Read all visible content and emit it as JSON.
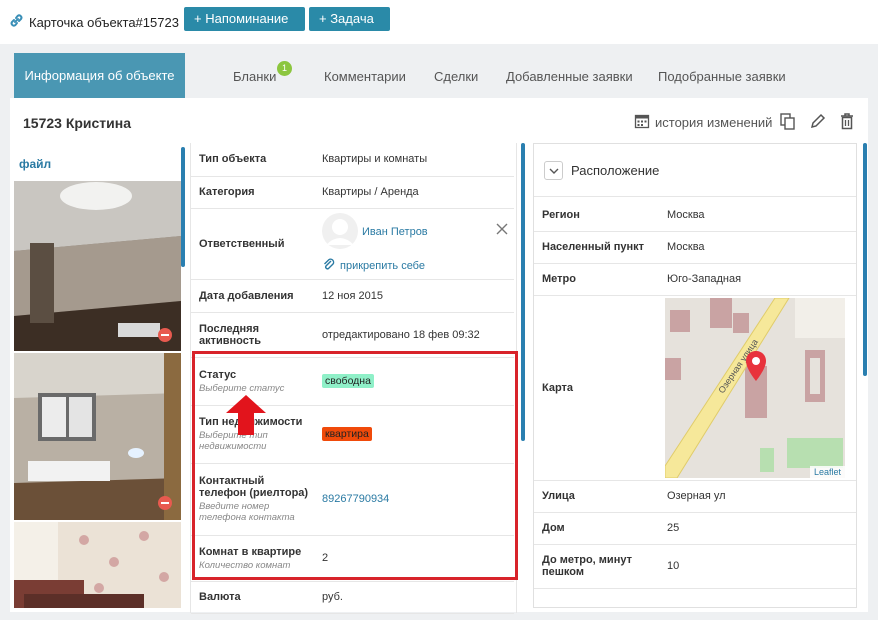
{
  "header": {
    "object_card": "Карточка объекта#15723",
    "reminder_button": "+ Напоминание",
    "task_button": "+ Задача"
  },
  "tabs": {
    "active": "Информация об объекте",
    "forms": "Бланки",
    "forms_badge": "1",
    "comments": "Комментарии",
    "deals": "Сделки",
    "added_requests": "Добавленные заявки",
    "matched_requests": "Подобранные заявки"
  },
  "page": {
    "title": "15723 Кристина",
    "history": "история изменений",
    "file_link": "файл"
  },
  "details": {
    "object_type_label": "Тип объекта",
    "object_type_value": "Квартиры и комнаты",
    "category_label": "Категория",
    "category_value": "Квартиры / Аренда",
    "responsible_label": "Ответственный",
    "responsible_name": "Иван Петров",
    "attach_self": "прикрепить себе",
    "added_date_label": "Дата добавления",
    "added_date_value": "12 ноя 2015",
    "last_activity_label": "Последняя активность",
    "last_activity_value": "отредактировано 18 фев 09:32",
    "status_label": "Статус",
    "status_hint": "Выберите статус",
    "status_value": "свободна",
    "property_type_label": "Тип недвижимости",
    "property_type_hint": "Выберите тип недвижимости",
    "property_type_value": "квартира",
    "phone_label": "Контактный телефон (риелтора)",
    "phone_hint": "Введите номер телефона контакта",
    "phone_value": "89267790934",
    "rooms_label": "Комнат в квартире",
    "rooms_hint": "Количество комнат",
    "rooms_value": "2",
    "currency_label": "Валюта",
    "currency_value": "руб."
  },
  "location": {
    "section_title": "Расположение",
    "region_label": "Регион",
    "region_value": "Москва",
    "settlement_label": "Населенный пункт",
    "settlement_value": "Москва",
    "metro_label": "Метро",
    "metro_value": "Юго-Западная",
    "map_label": "Карта",
    "map_street_text": "Озерная улица",
    "map_attribution": "Leaflet",
    "street_label": "Улица",
    "street_value": "Озерная ул",
    "house_label": "Дом",
    "house_value": "25",
    "metro_minutes_label": "До метро, минут пешком",
    "metro_minutes_value": "10"
  },
  "colors": {
    "teal_button": "#2a8aa8",
    "active_tab": "#4a97b3",
    "badge_green": "#8cc63f",
    "status_tag": "#8ff0c8",
    "property_tag": "#f04a0a",
    "highlight_red": "#d8232a",
    "link_blue": "#2a7aa3",
    "map_pin": "#e8323c"
  },
  "icons": {
    "object_link": "link-icon",
    "history": "calendar-icon",
    "copy": "copy-icon",
    "edit": "pencil-icon",
    "delete": "trash-icon",
    "remove_responsible": "close-icon",
    "attach": "paperclip-icon",
    "collapse": "chevron-down-icon",
    "map_pin": "map-marker-icon",
    "photo_delete": "delete-photo-icon"
  }
}
